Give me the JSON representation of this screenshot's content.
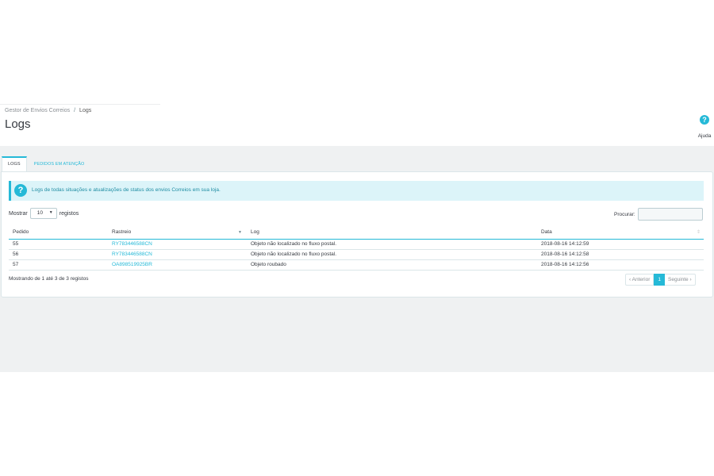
{
  "breadcrumb": {
    "parent": "Gestor de Envios Correios",
    "separator": "/",
    "current": "Logs"
  },
  "page": {
    "title": "Logs"
  },
  "help": {
    "icon": "help-circle-icon",
    "symbol": "?",
    "label": "Ajuda"
  },
  "tabs": [
    {
      "label": "Logs",
      "active": true
    },
    {
      "label": "Pedidos em atenção",
      "active": false
    }
  ],
  "alert": {
    "icon": "question-circle-icon",
    "symbol": "?",
    "text": "Logs de todas situações e atualizações de status dos envios Correios em sua loja."
  },
  "length": {
    "prefix": "Mostrar",
    "value": "10",
    "suffix": "registos"
  },
  "search": {
    "label": "Procurar:",
    "value": ""
  },
  "table": {
    "columns": [
      "Pedido",
      "Rastreio",
      "Log",
      "Data"
    ],
    "rows": [
      {
        "pedido": "55",
        "rastreio": "RY783446588CN",
        "log": "Objeto não localizado no fluxo postal.",
        "data": "2018-08-16 14:12:59"
      },
      {
        "pedido": "56",
        "rastreio": "RY783446588CN",
        "log": "Objeto não localizado no fluxo postal.",
        "data": "2018-08-16 14:12:58"
      },
      {
        "pedido": "57",
        "rastreio": "OA898519925BR",
        "log": "Objeto roubado",
        "data": "2018-08-16 14:12:56"
      }
    ]
  },
  "info": "Mostrando de 1 até 3 de 3 registos",
  "pagination": {
    "prev": "Anterior",
    "current": "1",
    "next": "Seguinte"
  },
  "colors": {
    "accent": "#25b9d7",
    "background": "#eff1f2",
    "alert_bg": "#dcf4f9",
    "text": "#363a41"
  }
}
